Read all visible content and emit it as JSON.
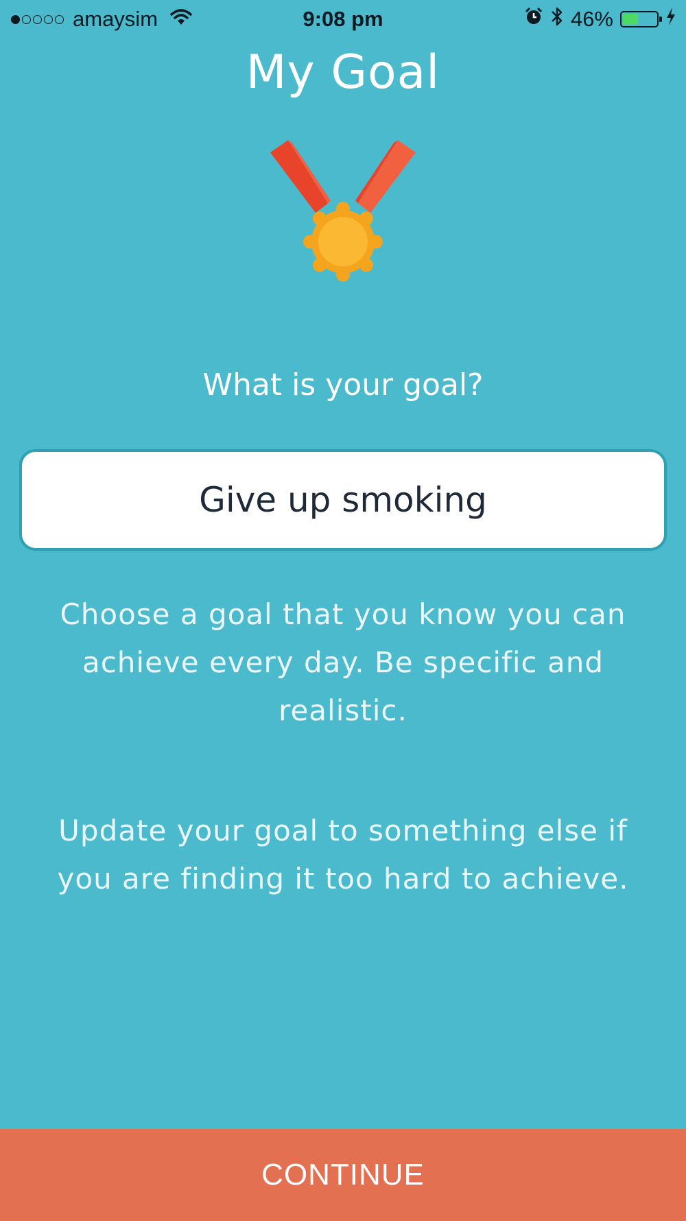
{
  "status_bar": {
    "carrier": "amaysim",
    "signal_strength": 1,
    "signal_max": 5,
    "time": "9:08 pm",
    "battery_percent": "46%",
    "battery_level": 0.46,
    "icons": [
      "wifi-icon",
      "alarm-icon",
      "bluetooth-icon",
      "charging-icon"
    ]
  },
  "header": {
    "title": "My Goal"
  },
  "medal": {
    "icon": "medal-icon",
    "colors": {
      "ribbon": "#e8442b",
      "ribbon_light": "#f2613f",
      "medal_outer": "#f4a41d",
      "medal_inner": "#fbb933"
    }
  },
  "form": {
    "question": "What is your goal?",
    "goal_value": "Give up smoking"
  },
  "hints": [
    "Choose a goal that you know you can achieve every day. Be specific and realistic.",
    "Update your goal to something else if you are finding it too hard to achieve."
  ],
  "footer": {
    "continue_label": "CONTINUE"
  },
  "colors": {
    "background": "#4bbacd",
    "input_border": "#2f9fb3",
    "continue_button": "#e37051"
  }
}
